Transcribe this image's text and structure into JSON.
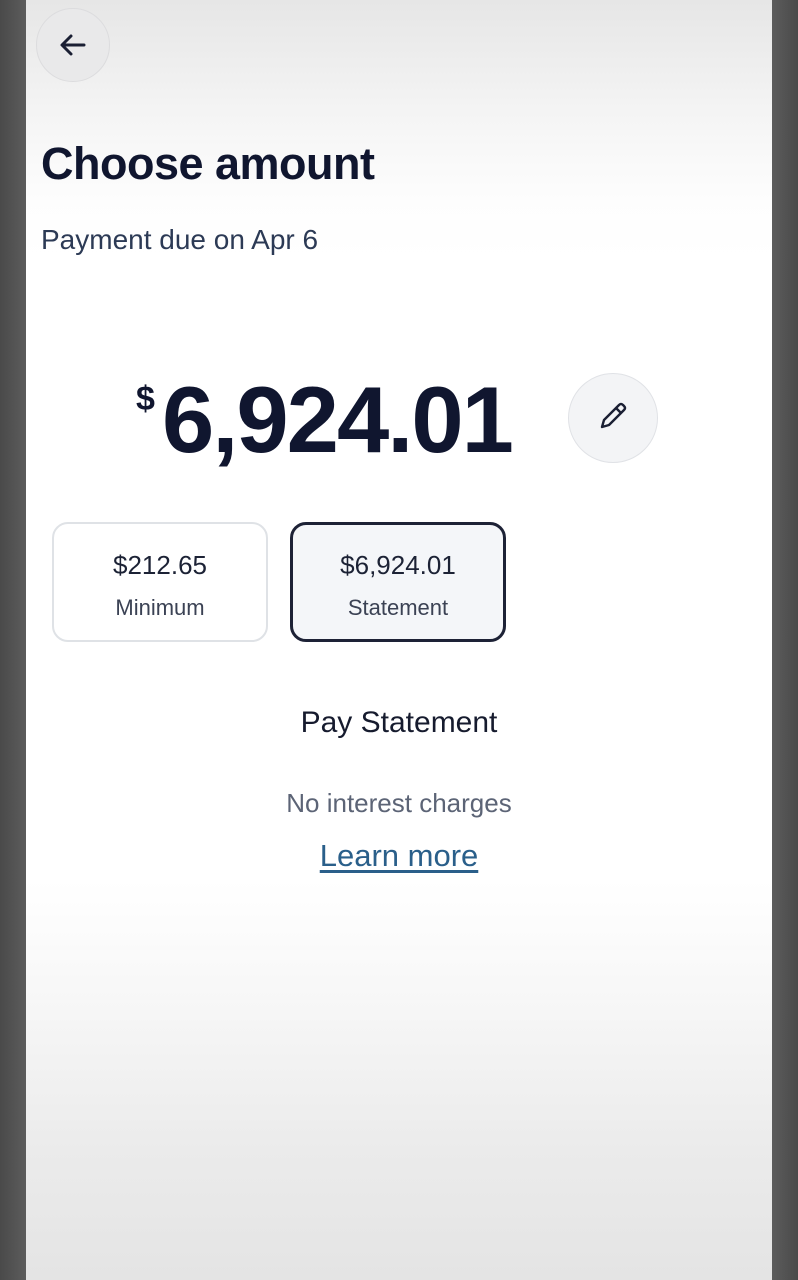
{
  "header": {
    "back_icon": "arrow-left-icon",
    "title": "Choose amount",
    "due_text": "Payment due on Apr 6"
  },
  "amount": {
    "currency_symbol": "$",
    "value": "6,924.01",
    "edit_icon": "pencil-icon"
  },
  "options": [
    {
      "amount": "$212.65",
      "label": "Minimum",
      "selected": false
    },
    {
      "amount": "$6,924.01",
      "label": "Statement",
      "selected": true
    }
  ],
  "details": {
    "heading": "Pay Statement",
    "note": "No interest charges",
    "link": "Learn more"
  },
  "colors": {
    "primary_text": "#10162f",
    "link": "#2a5f8a",
    "selected_border": "#1d2236"
  }
}
